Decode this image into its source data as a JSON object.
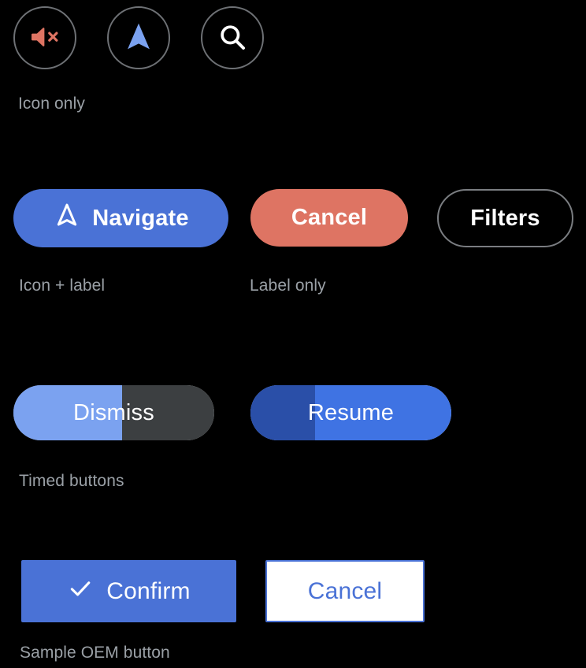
{
  "page": {
    "background": "#000000",
    "label_color": "#9aa0a6"
  },
  "colors": {
    "accent_blue": "#4a72d6",
    "light_blue": "#7ba2f0",
    "dark_blue": "#2a4fa8",
    "coral_red": "#de7463",
    "outline_gray": "#7a7d81",
    "track_gray": "#3c3f41",
    "white": "#ffffff"
  },
  "sections": [
    {
      "id": "icon-only",
      "label": "Icon only",
      "buttons": [
        {
          "name": "mute-button",
          "icon": "volume-mute-icon",
          "icon_color": "#de7463"
        },
        {
          "name": "navigate-button",
          "icon": "navigation-arrow-icon",
          "icon_color": "#7ba2f0"
        },
        {
          "name": "search-button",
          "icon": "search-icon",
          "icon_color": "#ffffff"
        }
      ]
    },
    {
      "id": "icon-label",
      "label": "Icon + label",
      "label2": "Label only",
      "buttons": [
        {
          "name": "navigate-button",
          "label": "Navigate",
          "icon": "navigation-arrow-outline-icon",
          "style": "filled-blue"
        },
        {
          "name": "cancel-button",
          "label": "Cancel",
          "icon": null,
          "style": "filled-red"
        },
        {
          "name": "filters-button",
          "label": "Filters",
          "icon": null,
          "style": "outlined"
        }
      ]
    },
    {
      "id": "timed",
      "label": "Timed buttons",
      "buttons": [
        {
          "name": "dismiss-button",
          "label": "Dismiss",
          "progress": 54,
          "fill_color": "#7ba2f0",
          "track_color": "#3c3f41"
        },
        {
          "name": "resume-button",
          "label": "Resume",
          "progress": 32,
          "fill_color": "#2a4fa8",
          "track_color": "#3f73e3"
        }
      ]
    },
    {
      "id": "oem",
      "label": "Sample OEM button",
      "buttons": [
        {
          "name": "confirm-button",
          "label": "Confirm",
          "icon": "check-icon",
          "style": "primary"
        },
        {
          "name": "cancel-button",
          "label": "Cancel",
          "icon": null,
          "style": "secondary"
        }
      ]
    }
  ]
}
